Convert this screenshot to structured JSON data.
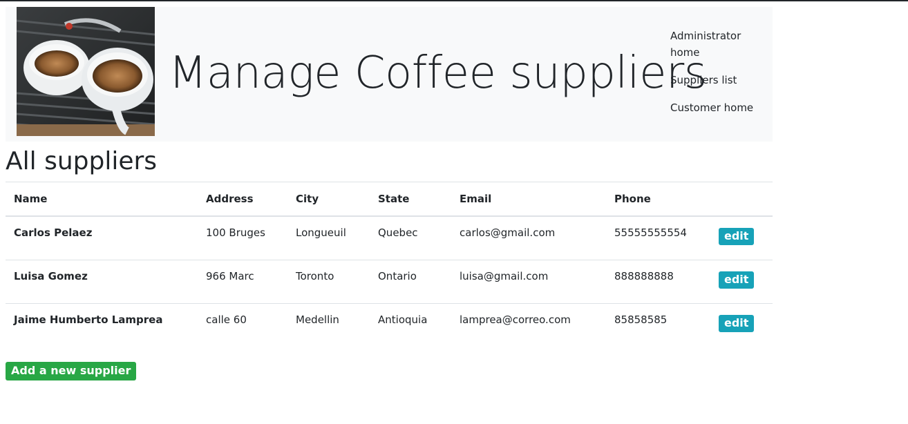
{
  "header": {
    "title": "Manage Coffee suppliers",
    "image_icon": "coffee-cups-photo",
    "nav": [
      {
        "label": "Administrator home"
      },
      {
        "label": "Suppliers list"
      },
      {
        "label": "Customer home"
      }
    ]
  },
  "main": {
    "section_title": "All suppliers",
    "table": {
      "columns": [
        "Name",
        "Address",
        "City",
        "State",
        "Email",
        "Phone",
        ""
      ],
      "rows": [
        {
          "name": "Carlos Pelaez",
          "address": "100 Bruges",
          "city": "Longueuil",
          "state": "Quebec",
          "email": "carlos@gmail.com",
          "phone": "55555555554",
          "action": "edit"
        },
        {
          "name": "Luisa Gomez",
          "address": "966 Marc",
          "city": "Toronto",
          "state": "Ontario",
          "email": "luisa@gmail.com",
          "phone": "888888888",
          "action": "edit"
        },
        {
          "name": "Jaime Humberto Lamprea",
          "address": "calle 60",
          "city": "Medellin",
          "state": "Antioquia",
          "email": "lamprea@correo.com",
          "phone": "85858585",
          "action": "edit"
        }
      ]
    },
    "add_button": "Add a new supplier"
  },
  "colors": {
    "banner_bg": "#f8f9fa",
    "edit_button": "#17a2b8",
    "add_button": "#28a745",
    "text": "#212529"
  }
}
